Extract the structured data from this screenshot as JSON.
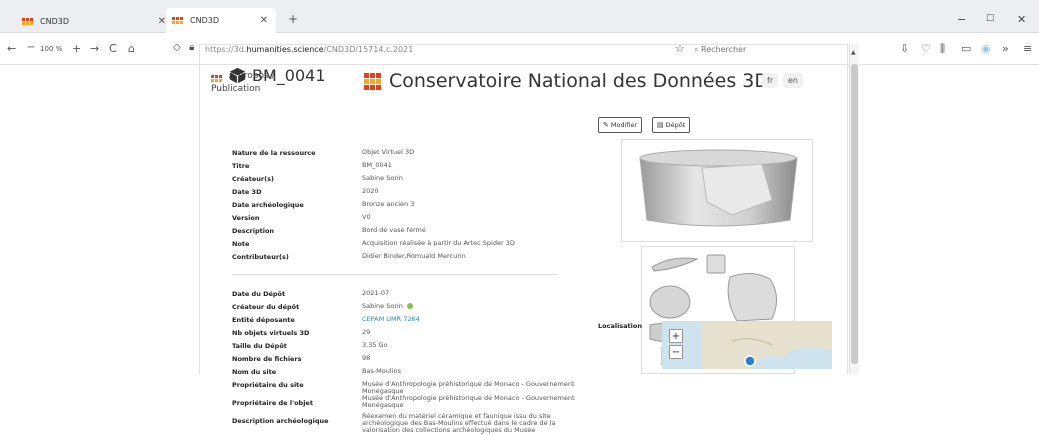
{
  "browser": {
    "tabs": [
      {
        "label": "CND3D"
      },
      {
        "label": "CND3D"
      }
    ],
    "zoom": "100 %",
    "url_prefix": "https://3d.",
    "url_host": "humanities.science",
    "url_path": "/CND3D/15714.c.2021",
    "search_placeholder": "Rechercher"
  },
  "site": {
    "apropos": "A propos /",
    "publication": "Publication",
    "title": "Conservatoire National des Données 3D",
    "lang_fr": "fr",
    "lang_en": "en"
  },
  "object": {
    "title": "BM_0041",
    "btn_modifier": "Modifier",
    "btn_depot": "Dépôt"
  },
  "meta1": [
    {
      "k": "Nature de la ressource",
      "v": "Objet Virtuel 3D"
    },
    {
      "k": "Titre",
      "v": "BM_0041"
    },
    {
      "k": "Créateur(s)",
      "v": "Sabine Sorin"
    },
    {
      "k": "Date 3D",
      "v": "2020"
    },
    {
      "k": "Date archéologique",
      "v": "Bronze ancien 3"
    },
    {
      "k": "Version",
      "v": "V0"
    },
    {
      "k": "Description",
      "v": "Bord de vase fermé"
    },
    {
      "k": "Note",
      "v": "Acquisition réalisée à partir du Artec Spider 3D"
    },
    {
      "k": "Contributeur(s)",
      "v": "Didier Binder,Romuald Mercurin"
    }
  ],
  "meta2": [
    {
      "k": "Date du Dépôt",
      "v": "2021-07"
    },
    {
      "k": "Créateur du dépôt",
      "v": "Sabine Sorin"
    },
    {
      "k": "Entité déposante",
      "v": "CEPAM UMR 7264"
    },
    {
      "k": "Nb objets virtuels 3D",
      "v": "29"
    },
    {
      "k": "Taille du Dépôt",
      "v": "3,35 Go"
    },
    {
      "k": "Nombre de fichiers",
      "v": "98"
    },
    {
      "k": "Nom du site",
      "v": "Bas-Moulins"
    },
    {
      "k": "Propriétaire du site",
      "v": "Musée d'Anthropologie préhistorique de Monaco - Gouvernement Monégasque"
    },
    {
      "k": "Propriétaire de l'objet",
      "v": "Musée d'Anthropologie préhistorique de Monaco - Gouvernement Monégasque"
    },
    {
      "k": "Description archéologique",
      "v": "Réexamen du matériel céramique et faunique issu du site archéologique des Bas-Moulins effectué dans le cadre de la valorisation des collections archéologiques du Musée"
    }
  ],
  "map": {
    "label": "Localisation",
    "zoom_in": "+",
    "zoom_out": "−"
  },
  "colors": {
    "accent": "#e0421a",
    "accent2": "#f6a623",
    "link": "#2b8ab8",
    "online": "#8bc34a"
  }
}
